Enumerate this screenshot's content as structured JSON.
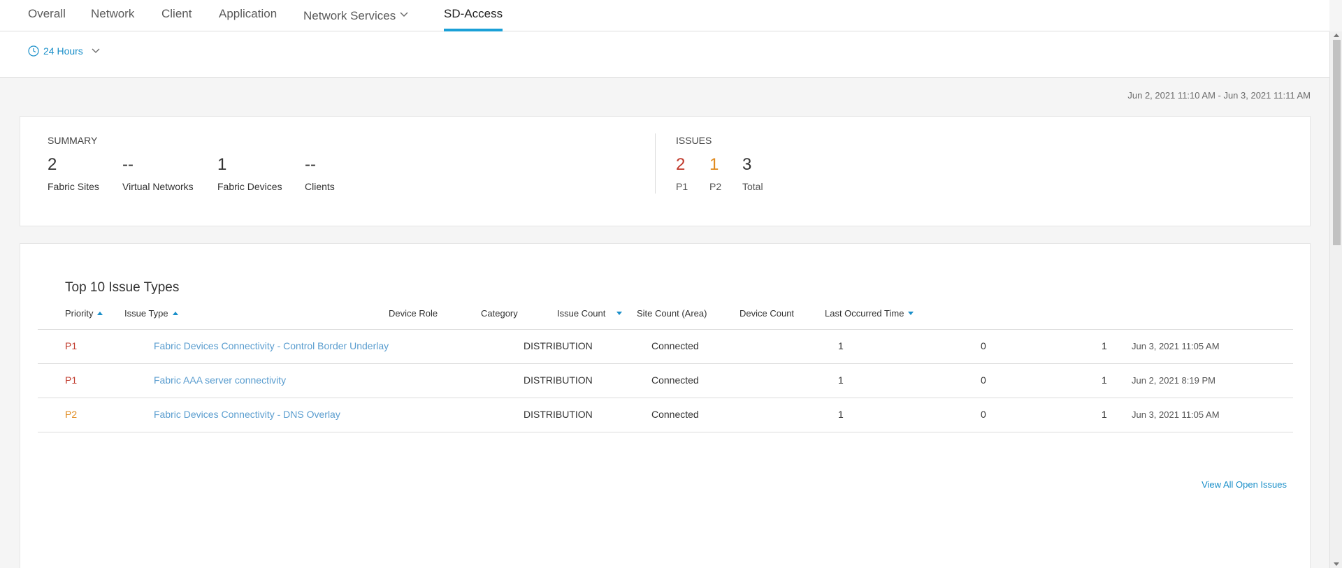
{
  "tabs": [
    {
      "label": "Overall"
    },
    {
      "label": "Network"
    },
    {
      "label": "Client"
    },
    {
      "label": "Application"
    },
    {
      "label": "Network Services"
    },
    {
      "label": "SD-Access"
    }
  ],
  "active_tab": "SD-Access",
  "time_selector": {
    "label": "24 Hours",
    "icon": "clock-icon"
  },
  "date_range": "Jun 2, 2021 11:10 AM - Jun 3, 2021 11:11 AM",
  "summary": {
    "title": "SUMMARY",
    "metrics": [
      {
        "value": "2",
        "label": "Fabric Sites"
      },
      {
        "value": "--",
        "label": "Virtual Networks"
      },
      {
        "value": "1",
        "label": "Fabric Devices"
      },
      {
        "value": "--",
        "label": "Clients"
      }
    ]
  },
  "issues_summary": {
    "title": "ISSUES",
    "metrics": [
      {
        "value": "2",
        "label": "P1",
        "color": "#c0392b"
      },
      {
        "value": "1",
        "label": "P2",
        "color": "#e08a1e"
      },
      {
        "value": "3",
        "label": "Total",
        "color": "#333333"
      }
    ]
  },
  "issue_table": {
    "title": "Top 10 Issue Types",
    "columns": [
      "Priority",
      "Issue Type",
      "Device Role",
      "Category",
      "Issue Count",
      "Site Count (Area)",
      "Device Count",
      "Last Occurred Time"
    ],
    "rows": [
      {
        "priority": "P1",
        "issue_type": "Fabric Devices Connectivity - Control Border Underlay",
        "device_role": "DISTRIBUTION",
        "category": "Connected",
        "issue_count": "1",
        "site_count": "0",
        "device_count": "1",
        "last_time": "Jun 3, 2021 11:05 AM"
      },
      {
        "priority": "P1",
        "issue_type": "Fabric AAA server connectivity",
        "device_role": "DISTRIBUTION",
        "category": "Connected",
        "issue_count": "1",
        "site_count": "0",
        "device_count": "1",
        "last_time": "Jun 2, 2021 8:19 PM"
      },
      {
        "priority": "P2",
        "issue_type": "Fabric Devices Connectivity - DNS Overlay",
        "device_role": "DISTRIBUTION",
        "category": "Connected",
        "issue_count": "1",
        "site_count": "0",
        "device_count": "1",
        "last_time": "Jun 3, 2021 11:05 AM"
      }
    ],
    "view_all_label": "View All Open Issues"
  },
  "colors": {
    "accent": "#1ba0d7",
    "link": "#1a8fc9",
    "p1": "#c0392b",
    "p2": "#e08a1e"
  }
}
